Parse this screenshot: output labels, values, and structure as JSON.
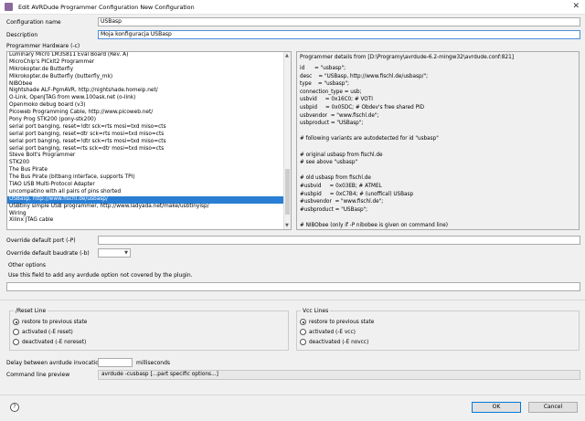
{
  "window": {
    "title": "Edit AVRDude Programmer Configuration New Configuration",
    "close_glyph": "✕"
  },
  "config_name": {
    "label": "Configuration name",
    "value": "USBasp"
  },
  "description": {
    "label": "Description",
    "value": "Moja konfiguracja USBasp"
  },
  "hardware": {
    "label": "Programmer Hardware (-c)",
    "items": [
      "Luminary Micro LM3S811 Eval Board (Rev. A)",
      "MicroChip's PICkit2 Programmer",
      "Mikrokopter.de Butterfly",
      "Mikrokopter.de Butterfly (butterfly_mk)",
      "NIBObee",
      "Nightshade ALF-PgmAVR, http://nightshade.homeip.net/",
      "O-Link, OpenJTAG from www.100ask.net (o-link)",
      "Openmoko debug board (v3)",
      "Picoweb Programming Cable, http://www.picoweb.net/",
      "Pony Prog STK200 (pony-stk200)",
      "serial port banging, reset=!dtr sck=rts mosi=txd miso=cts",
      "serial port banging, reset=dtr sck=rts mosi=txd miso=cts",
      "serial port banging, reset=!dtr sck=rts mosi=txd miso=cts",
      "serial port banging, reset=rts sck=dtr mosi=txd miso=cts",
      "Steve Bolt's Programmer",
      "STK200",
      "The Bus Pirate",
      "The Bus Pirate (bitbang interface, supports TPI)",
      "TIAO USB Multi-Protocol Adapter",
      "uncompatino with all pairs of pins shorted",
      "USBasp, http://www.fischl.de/usbasp/",
      "USBtiny simple USB programmer, http://www.ladyada.net/make/usbtinyisp/",
      "Wiring",
      "Xilinx JTAG cable"
    ],
    "selected": "USBasp, http://www.fischl.de/usbasp/"
  },
  "details": {
    "header": "Programmer details from [D:\\Programy\\avrdude-6.2-mingw32\\avrdude.conf:821]",
    "lines": [
      "id      = \"usbasp\";",
      "desc    = \"USBasp, http://www.fischl.de/usbasp/\";",
      "type    = \"usbasp\";",
      "connection_type = usb;",
      "usbvid     = 0x16C0; # VOTI",
      "usbpid     = 0x05DC; # Obdev's free shared PID",
      "usbvendor  = \"www.fischl.de\";",
      "usbproduct = \"USBasp\";",
      "",
      "# following variants are autodetected for id \"usbasp\"",
      "",
      "# original usbasp from fischl.de",
      "# see above \"usbasp\"",
      "",
      "# old usbasp from fischl.de",
      "#usbvid     = 0x03EB; # ATMEL",
      "#usbpid     = 0xC7B4; # (unoffical) USBasp",
      "#usbvendor  = \"www.fischl.de\";",
      "#usbproduct = \"USBasp\";",
      "",
      "# NIBObee (only if -P nibobee is given on command line)"
    ]
  },
  "override_port": {
    "label": "Override default port (-P)",
    "value": ""
  },
  "override_baud": {
    "label": "Override default baudrate (-b)",
    "value": ""
  },
  "other_options": {
    "title": "Other options",
    "hint": "Use this field to add any avrdude option not covered by the plugin.",
    "value": ""
  },
  "reset_line": {
    "title": "/Reset Line",
    "options": [
      "restore to previous state",
      "activated (-E reset)",
      "deactivated (-E noreset)"
    ],
    "selected": "restore to previous state"
  },
  "vcc_lines": {
    "title": "Vcc Lines",
    "options": [
      "restore to previous state",
      "activated (-E vcc)",
      "deactivated (-E novcc)"
    ],
    "selected": "restore to previous state"
  },
  "delay": {
    "label": "Delay between avrdude invocations",
    "value": "",
    "unit": "milliseconds"
  },
  "cmdline": {
    "label": "Command line preview",
    "value": "avrdude -cusbasp [...part specific options...]"
  },
  "buttons": {
    "ok": "OK",
    "cancel": "Cancel",
    "help": "?"
  },
  "icons": [
    "avrdude-app-icon",
    "close-icon",
    "help-icon",
    "scroll-up-icon",
    "scroll-down-icon",
    "dropdown-arrow-icon"
  ]
}
